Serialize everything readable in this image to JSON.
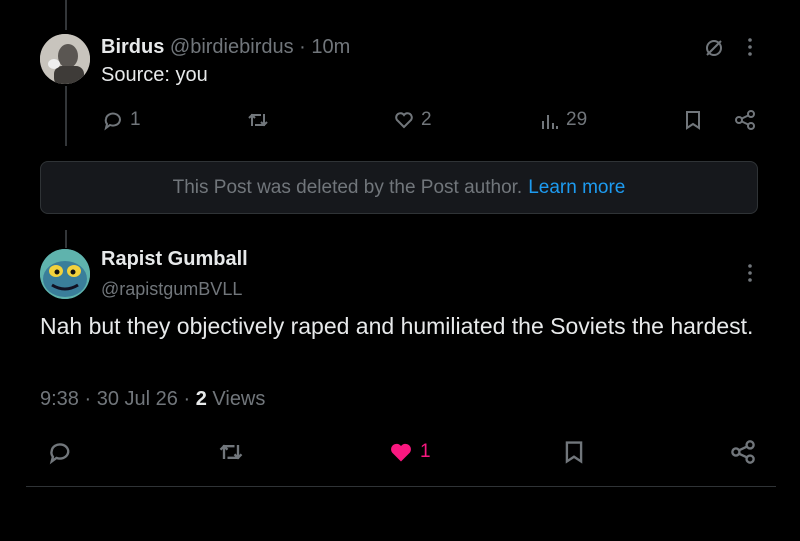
{
  "reply": {
    "display_name": "Birdus",
    "handle": "@birdiebirdus",
    "time": "10m",
    "text": "Source: you",
    "replies": "1",
    "likes": "2",
    "views": "29"
  },
  "deleted_notice": {
    "text": "This Post was deleted by the Post author.",
    "link": "Learn more"
  },
  "main_post": {
    "display_name": "Rapist Gumball",
    "handle": "@rapistgumBVLL",
    "text": "Nah but they objectively raped and humiliated the Soviets the hardest.",
    "time": "9:38",
    "date": "30 Jul 26",
    "views_count": "2",
    "views_label": "Views",
    "likes": "1"
  },
  "colors": {
    "accent": "#1d9bf0",
    "like": "#f91880",
    "muted": "#71767b"
  }
}
